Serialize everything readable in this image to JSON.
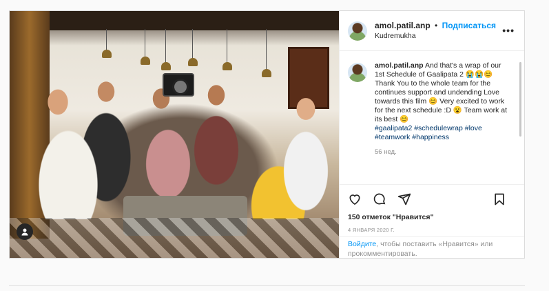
{
  "post": {
    "username": "amol.patil.anp",
    "dot": "•",
    "follow_label": "Подписаться",
    "location": "Kudremukha",
    "more_label": "•••"
  },
  "caption": {
    "username": "amol.patil.anp",
    "line1": "And that's a wrap of our 1st Schedule of Gaalipata 2 😭😭😊",
    "line2": "Thank You to the whole team for the continues support and undending Love towards this film 😊 Very excited to work for the next schedule :D 😮 Team work at its best 😊",
    "hashtags": "#gaalipata2 #schedulewrap #love #teamwork #happiness",
    "age": "56 нед."
  },
  "actions": {
    "like_icon": "heart-icon",
    "comment_icon": "comment-icon",
    "share_icon": "share-icon",
    "save_icon": "bookmark-icon"
  },
  "likes": "150 отметок \"Нравится\"",
  "date": "4 ЯНВАРЯ 2020 Г.",
  "login_prompt": {
    "link": "Войдите",
    "rest": ", чтобы поставить «Нравится» или прокомментировать."
  }
}
